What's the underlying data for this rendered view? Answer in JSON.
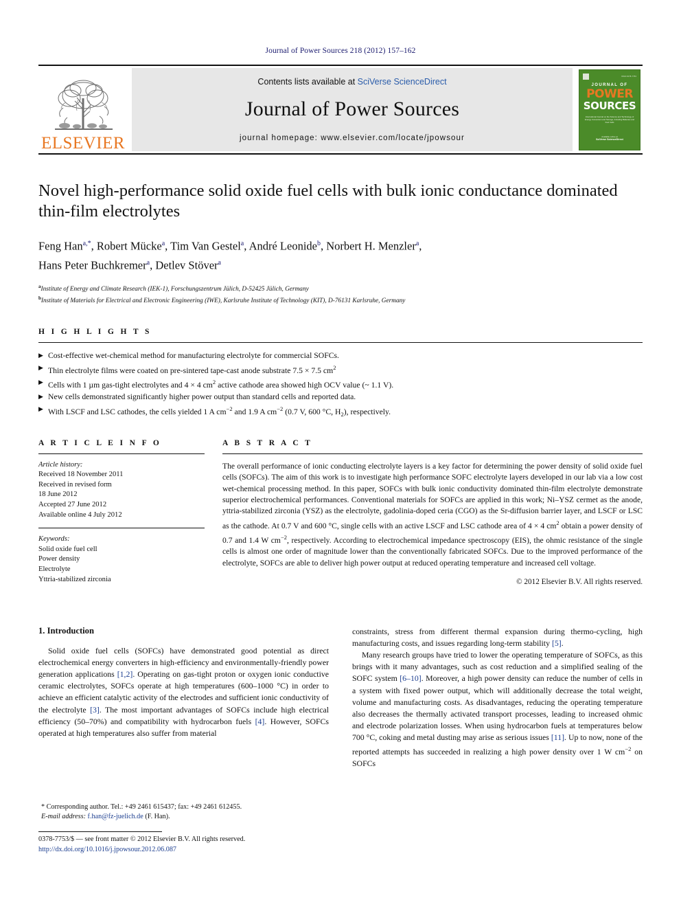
{
  "running_head": "Journal of Power Sources 218 (2012) 157–162",
  "masthead": {
    "publisher_name": "ELSEVIER",
    "contents_prefix": "Contents lists available at ",
    "contents_link": "SciVerse ScienceDirect",
    "journal_title": "Journal of Power Sources",
    "homepage": "journal homepage: www.elsevier.com/locate/jpowsour",
    "cover": {
      "top_tiny": "ISSN 0378-7753",
      "line1": "JOURNAL OF",
      "line2": "POWER",
      "line3": "SOURCES",
      "subtitle": "International Journal on the Science and Technology of Energy Conversion and Storage, Including Batteries and Fuel Cells",
      "bottom_label": "Available online at",
      "bottom_brand": "SciVerse ScienceDirect"
    }
  },
  "article": {
    "title": "Novel high-performance solid oxide fuel cells with bulk ionic conductance dominated thin-film electrolytes",
    "authors_line1": "Feng Han a,*, Robert Mücke a, Tim Van Gestel a, André Leonide b, Norbert H. Menzler a,",
    "authors_line2": "Hans Peter Buchkremer a, Detlev Stöver a",
    "affiliation_a": "Institute of Energy and Climate Research (IEK-1), Forschungszentrum Jülich, D-52425 Jülich, Germany",
    "affiliation_b": "Institute of Materials for Electrical and Electronic Engineering (IWE), Karlsruhe Institute of Technology (KIT), D-76131 Karlsruhe, Germany"
  },
  "highlights": {
    "heading": "H I G H L I G H T S",
    "items": [
      "Cost-effective wet-chemical method for manufacturing electrolyte for commercial SOFCs.",
      "Thin electrolyte films were coated on pre-sintered tape-cast anode substrate 7.5 × 7.5 cm2",
      "Cells with 1 μm gas-tight electrolytes and 4 × 4 cm2 active cathode area showed high OCV value (~ 1.1 V).",
      "New cells demonstrated significantly higher power output than standard cells and reported data.",
      "With LSCF and LSC cathodes, the cells yielded 1 A cm−2 and 1.9 A cm−2 (0.7 V, 600 °C, H2), respectively."
    ]
  },
  "article_info": {
    "heading": "A R T I C L E   I N F O",
    "history_label": "Article history:",
    "history": [
      "Received 18 November 2011",
      "Received in revised form",
      "18 June 2012",
      "Accepted 27 June 2012",
      "Available online 4 July 2012"
    ],
    "keywords_label": "Keywords:",
    "keywords": [
      "Solid oxide fuel cell",
      "Power density",
      "Electrolyte",
      "Yttria-stabilized zirconia"
    ]
  },
  "abstract": {
    "heading": "A B S T R A C T",
    "text": "The overall performance of ionic conducting electrolyte layers is a key factor for determining the power density of solid oxide fuel cells (SOFCs). The aim of this work is to investigate high performance SOFC electrolyte layers developed in our lab via a low cost wet-chemical processing method. In this paper, SOFCs with bulk ionic conductivity dominated thin-film electrolyte demonstrate superior electrochemical performances. Conventional materials for SOFCs are applied in this work; Ni–YSZ cermet as the anode, yttria-stabilized zirconia (YSZ) as the electrolyte, gadolinia-doped ceria (CGO) as the Sr-diffusion barrier layer, and LSCF or LSC as the cathode. At 0.7 V and 600 °C, single cells with an active LSCF and LSC cathode area of 4 × 4 cm2 obtain a power density of 0.7 and 1.4 W cm−2, respectively. According to electrochemical impedance spectroscopy (EIS), the ohmic resistance of the single cells is almost one order of magnitude lower than the conventionally fabricated SOFCs. Due to the improved performance of the electrolyte, SOFCs are able to deliver high power output at reduced operating temperature and increased cell voltage.",
    "copyright": "© 2012 Elsevier B.V. All rights reserved."
  },
  "body": {
    "section_number_title": "1.  Introduction",
    "left_paragraph": "Solid oxide fuel cells (SOFCs) have demonstrated good potential as direct electrochemical energy converters in high-efficiency and environmentally-friendly power generation applications [1,2]. Operating on gas-tight proton or oxygen ionic conductive ceramic electrolytes, SOFCs operate at high temperatures (600–1000 °C) in order to achieve an efficient catalytic activity of the electrodes and sufficient ionic conductivity of the electrolyte [3]. The most important advantages of SOFCs include high electrical efficiency (50–70%) and compatibility with hydrocarbon fuels [4]. However, SOFCs operated at high temperatures also suffer from material",
    "right_paragraph_1": "constraints, stress from different thermal expansion during thermo-cycling, high manufacturing costs, and issues regarding long-term stability [5].",
    "right_paragraph_2": "Many research groups have tried to lower the operating temperature of SOFCs, as this brings with it many advantages, such as cost reduction and a simplified sealing of the SOFC system [6–10]. Moreover, a high power density can reduce the number of cells in a system with fixed power output, which will additionally decrease the total weight, volume and manufacturing costs. As disadvantages, reducing the operating temperature also decreases the thermally activated transport processes, leading to increased ohmic and electrode polarization losses. When using hydrocarbon fuels at temperatures below 700 °C, coking and metal dusting may arise as serious issues [11]. Up to now, none of the reported attempts has succeeded in realizing a high power density over 1 W cm−2 on SOFCs"
  },
  "footnotes": {
    "corresponding": "* Corresponding author. Tel.: +49 2461 615437; fax: +49 2461 612455.",
    "email_label": "E-mail address:",
    "email": "f.han@fz-juelich.de",
    "email_suffix": "(F. Han)."
  },
  "imprint": {
    "line1": "0378-7753/$ — see front matter © 2012 Elsevier B.V. All rights reserved.",
    "doi": "http://dx.doi.org/10.1016/j.jpowsour.2012.06.087"
  },
  "colors": {
    "elsevier_orange": "#E87722",
    "link_blue": "#1b3d8f",
    "cover_green": "#4b8b29",
    "masthead_gray": "#e7e7e7"
  }
}
